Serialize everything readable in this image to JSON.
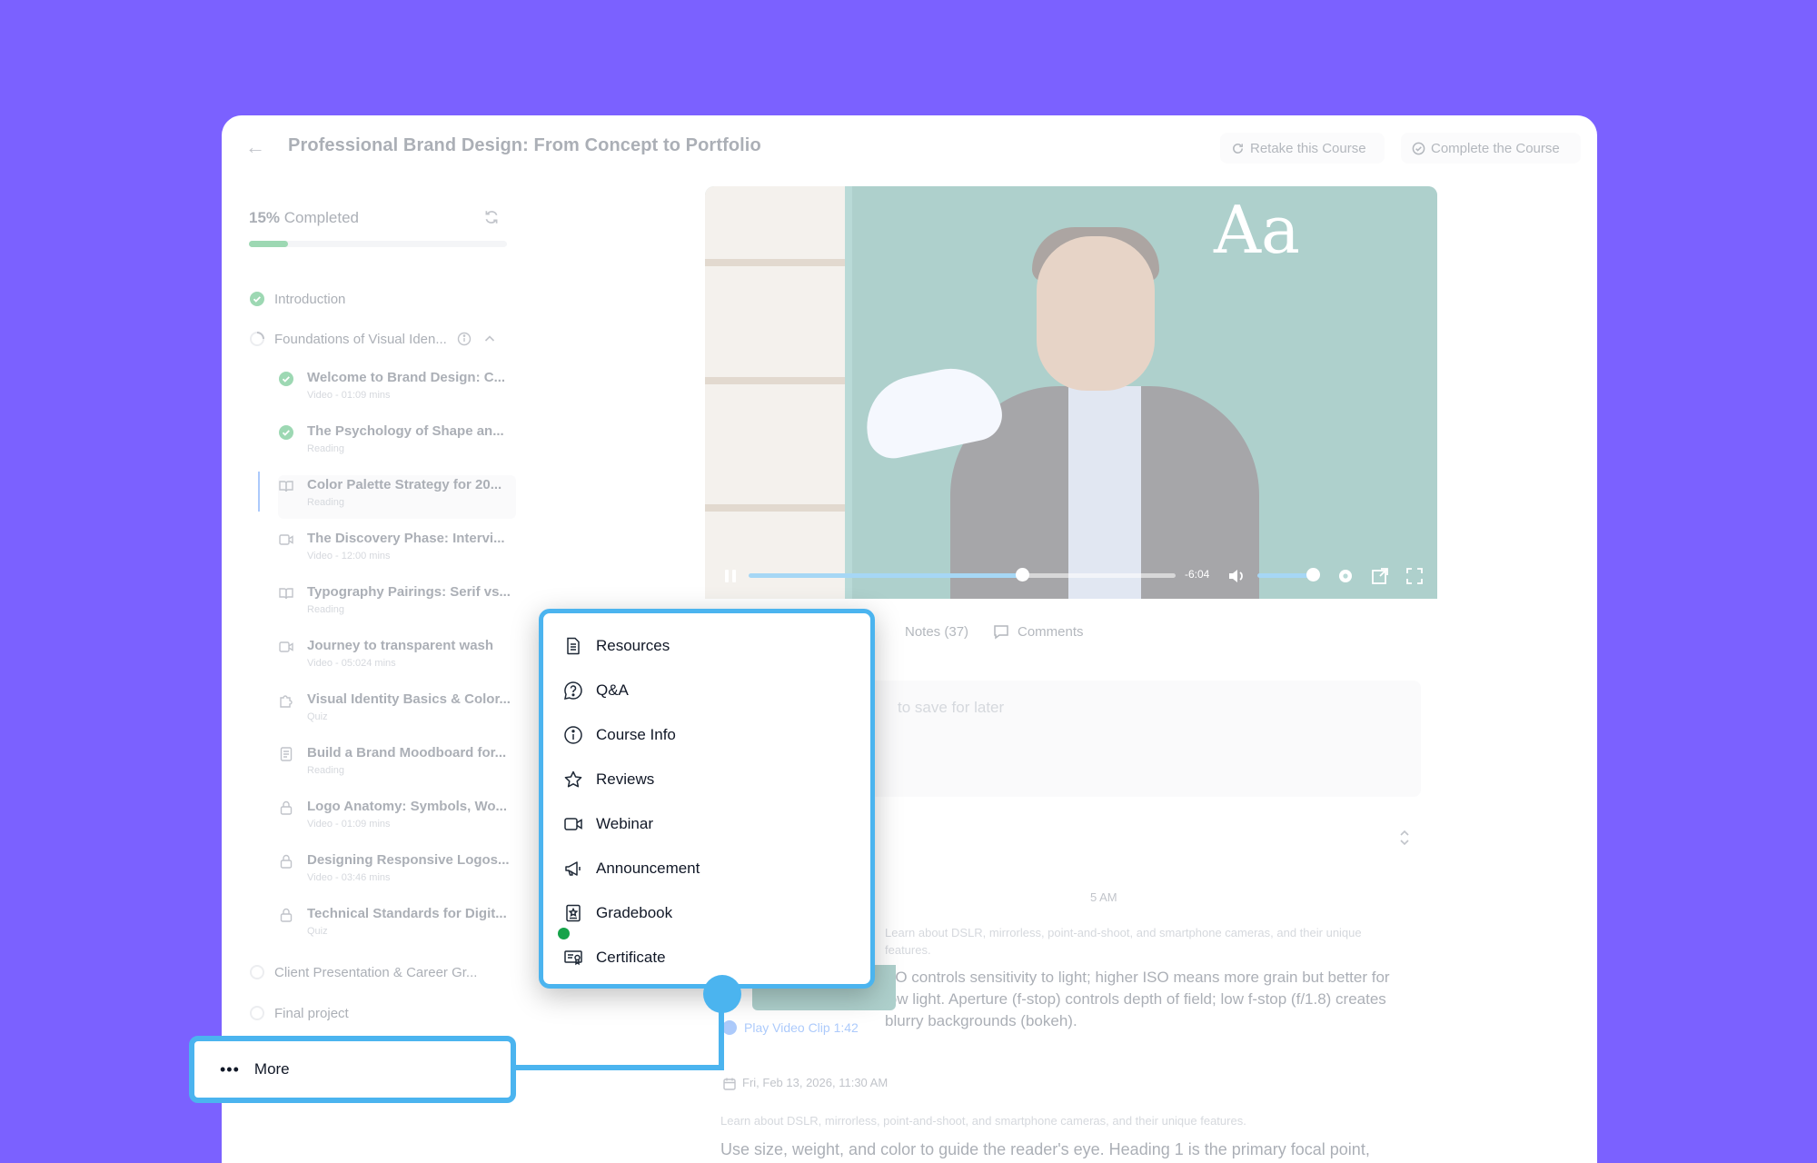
{
  "header": {
    "title": "Professional Brand Design: From Concept to Portfolio",
    "retake_label": "Retake this Course",
    "complete_label": "Complete the Course"
  },
  "progress": {
    "percent": 15,
    "percent_label": "15%",
    "label": "Completed"
  },
  "sidebar": {
    "sections": [
      {
        "title": "Introduction",
        "status": "completed"
      },
      {
        "title": "Foundations of Visual Iden...",
        "status": "in-progress"
      },
      {
        "title": "Client Presentation & Career Gr...",
        "status": "pending"
      },
      {
        "title": "Final project",
        "status": "pending"
      }
    ],
    "lessons": [
      {
        "title": "Welcome to Brand Design: C...",
        "meta": "Video - 01:09 mins",
        "icon": "check-circle-icon"
      },
      {
        "title": "The Psychology of Shape an...",
        "meta": "Reading",
        "icon": "check-circle-icon"
      },
      {
        "title": "Color Palette Strategy for 20...",
        "meta": "Reading",
        "icon": "book-icon"
      },
      {
        "title": "The Discovery Phase: Intervi...",
        "meta": "Video - 12:00 mins",
        "icon": "video-icon"
      },
      {
        "title": "Typography Pairings: Serif vs...",
        "meta": "Reading",
        "icon": "book-icon"
      },
      {
        "title": "Journey to transparent wash",
        "meta": "Video - 05:024 mins",
        "icon": "video-icon"
      },
      {
        "title": "Visual Identity Basics & Color...",
        "meta": "Quiz",
        "icon": "puzzle-icon"
      },
      {
        "title": "Build a Brand Moodboard for...",
        "meta": "Reading",
        "icon": "document-icon"
      },
      {
        "title": "Logo Anatomy: Symbols, Wo...",
        "meta": "Video - 01:09 mins",
        "icon": "lock-icon"
      },
      {
        "title": "Designing Responsive Logos...",
        "meta": "Video - 03:46 mins",
        "icon": "lock-icon"
      },
      {
        "title": "Technical Standards for Digit...",
        "meta": "Quiz",
        "icon": "lock-icon"
      }
    ]
  },
  "video": {
    "overlay_text": "Aa",
    "time_remaining": "-6:04",
    "played_fraction": 0.64,
    "volume_fraction": 0.9,
    "accent": "#2b9fe6"
  },
  "tabs": {
    "notes_label": "Notes (37)",
    "comments_label": "Comments"
  },
  "notes": {
    "placeholder": "to save for later",
    "first": {
      "time": "5 AM",
      "sub": "Learn about DSLR, mirrorless, point-and-shoot, and smartphone cameras, and their unique features.",
      "body": "SO controls sensitivity to light; higher ISO means more grain but better for low light. Aperture (f-stop) controls depth of field; low f-stop (f/1.8) creates blurry backgrounds (bokeh).",
      "clip_label": "Play Video Clip 1:42"
    },
    "second": {
      "time": "Fri, Feb 13, 2026, 11:30 AM",
      "sub": "Learn about DSLR, mirrorless, point-and-shoot, and smartphone cameras, and their unique features.",
      "body": "Use size, weight, and color to guide the reader's eye. Heading 1 is the primary focal point,"
    }
  },
  "menu": {
    "items": [
      {
        "label": "Resources",
        "icon": "document-icon"
      },
      {
        "label": "Q&A",
        "icon": "question-icon"
      },
      {
        "label": "Course Info",
        "icon": "info-icon"
      },
      {
        "label": "Reviews",
        "icon": "star-icon"
      },
      {
        "label": "Webinar",
        "icon": "video-icon"
      },
      {
        "label": "Announcement",
        "icon": "megaphone-icon"
      },
      {
        "label": "Gradebook",
        "icon": "gradebook-icon"
      },
      {
        "label": "Certificate",
        "icon": "certificate-icon"
      }
    ]
  },
  "more_button": {
    "label": "More"
  },
  "colors": {
    "background": "#7b61ff",
    "highlight": "#4bb4ef",
    "success": "#16a34a"
  }
}
